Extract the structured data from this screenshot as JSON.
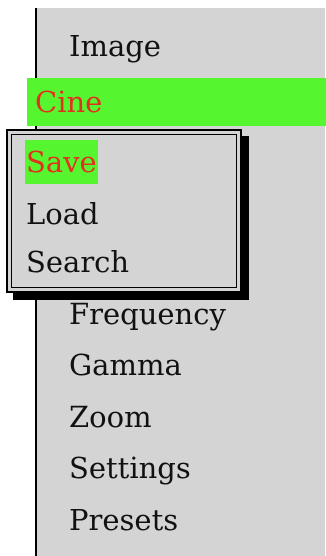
{
  "colors": {
    "highlight": "#55f630",
    "accent_text": "#e0321e",
    "panel": "#d4d4d4"
  },
  "menu": {
    "items": [
      {
        "label": "Image"
      },
      {
        "label": "Cine",
        "active": true
      },
      {
        "label": "Frequency"
      },
      {
        "label": "Gamma"
      },
      {
        "label": "Zoom"
      },
      {
        "label": "Settings"
      },
      {
        "label": "Presets"
      }
    ]
  },
  "popup": {
    "items": [
      {
        "label": "Save",
        "active": true
      },
      {
        "label": "Load"
      },
      {
        "label": "Search"
      }
    ]
  }
}
